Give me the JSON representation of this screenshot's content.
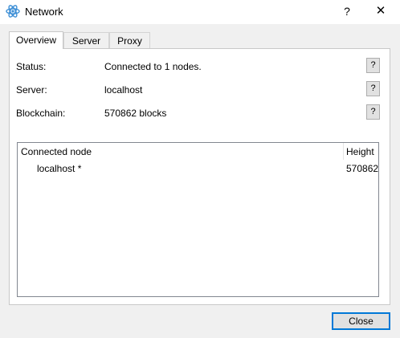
{
  "window": {
    "title": "Network",
    "help_label": "?",
    "close_label": "✕"
  },
  "tabs": [
    {
      "label": "Overview"
    },
    {
      "label": "Server"
    },
    {
      "label": "Proxy"
    }
  ],
  "overview": {
    "rows": [
      {
        "label": "Status:",
        "value": "Connected to 1 nodes.",
        "help": "?"
      },
      {
        "label": "Server:",
        "value": "localhost",
        "help": "?"
      },
      {
        "label": "Blockchain:",
        "value": "570862 blocks",
        "help": "?"
      }
    ],
    "table": {
      "columns": [
        "Connected node",
        "Height"
      ],
      "rows": [
        {
          "node": "localhost *",
          "height": "570862"
        }
      ]
    }
  },
  "footer": {
    "close_label": "Close"
  },
  "colors": {
    "accent": "#0078d7",
    "icon": "#3d8fd6"
  }
}
